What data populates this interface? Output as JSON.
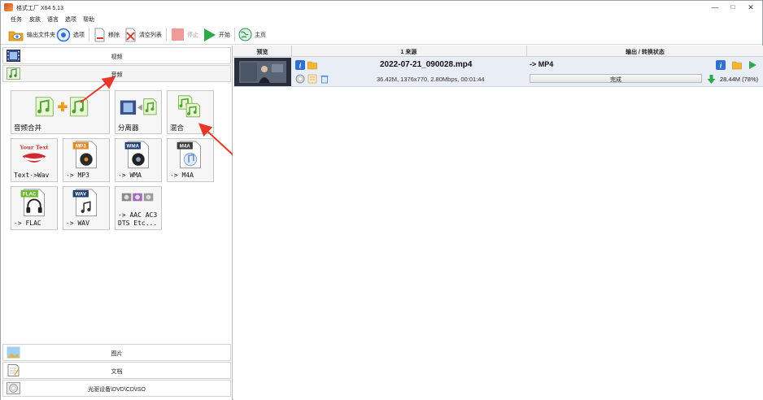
{
  "window": {
    "title": "格式工厂 X64 5.13",
    "minimize": "—",
    "maximize": "□",
    "close": "✕"
  },
  "menu": [
    "任务",
    "皮肤",
    "语言",
    "选项",
    "帮助"
  ],
  "toolbar": {
    "output_folder": "输出文件夹",
    "options": "选项",
    "remove": "移除",
    "clear_list": "清空列表",
    "stop": "停止",
    "start": "开始",
    "home": "主页"
  },
  "sidebar": {
    "video": "视频",
    "audio": "音频",
    "picture": "图片",
    "document": "文档",
    "disc": "光驱设备\\DVD\\CD\\ISO"
  },
  "audio_tools": [
    {
      "label": "音频合并",
      "icon": "audio-merge-icon"
    },
    {
      "label": "分离器",
      "icon": "splitter-icon"
    },
    {
      "label": "混合",
      "icon": "mix-icon"
    },
    {
      "label": "Text->Wav",
      "icon": "text-to-wav-icon",
      "badge": "Your Text"
    },
    {
      "label": "-> MP3",
      "icon": "mp3-icon",
      "badge": "MP3"
    },
    {
      "label": "-> WMA",
      "icon": "wma-icon",
      "badge": "WMA"
    },
    {
      "label": "-> M4A",
      "icon": "m4a-icon",
      "badge": "M4A"
    },
    {
      "label": "-> FLAC",
      "icon": "flac-icon",
      "badge": "FLAC"
    },
    {
      "label": "-> WAV",
      "icon": "wav-icon",
      "badge": "WAV"
    },
    {
      "label": "-> AAC AC3\nDTS Etc...",
      "icon": "aac-ac3-icon"
    }
  ],
  "task_table": {
    "headers": {
      "preview": "预览",
      "source": "1 来源",
      "status": "输出 / 转换状态"
    },
    "rows": [
      {
        "file_name": "2022-07-21_090028.mp4",
        "file_info": "36.42M, 1376x770, 2.80Mbps, 00:01:44",
        "output_format": "-> MP4",
        "status": "完成",
        "progress": 1.0,
        "output_size": "28.44M",
        "ratio": "(78%)"
      }
    ]
  },
  "colors": {
    "accent_green": "#2fa84f",
    "annotation_red": "#e8372a",
    "row_bg": "#e9eef6",
    "info_blue": "#2f6fd0",
    "folder_yellow": "#f2b630"
  }
}
